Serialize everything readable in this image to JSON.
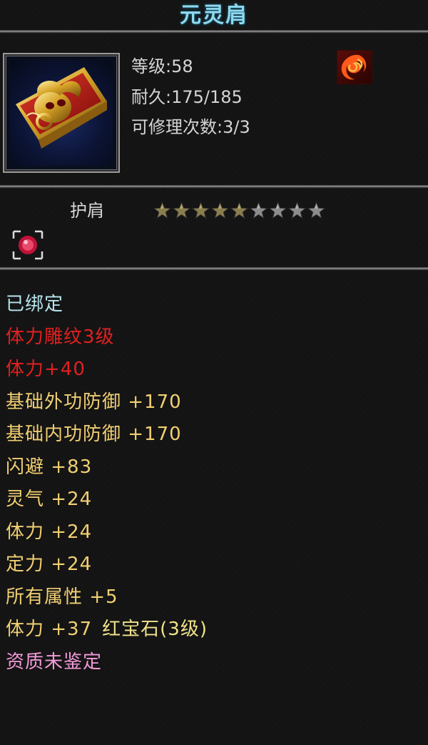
{
  "item": {
    "name": "元灵肩",
    "level_label": "等级",
    "level_value": "58",
    "durability_label": "耐久",
    "durability_value": "175/185",
    "repair_label": "可修理次数",
    "repair_value": "3/3",
    "type": "护肩",
    "stars_total": 9,
    "stars_filled": 5
  },
  "icons": {
    "item_icon": "red-gold-shoulder-armor-icon",
    "element_icon": "fire-swirl-icon",
    "gem_slot_icon": "red-gem-slot-icon",
    "star_icon": "star-icon"
  },
  "colors": {
    "title": "#8fd8ee",
    "bound": "#b6e4ec",
    "red": "#e02020",
    "gold": "#f1cf72",
    "gem": "#f0e28a",
    "pink": "#f29ad8",
    "star_filled": "#8a7d4e",
    "star_empty": "#8c8c8c"
  },
  "attributes": [
    {
      "text": "已绑定",
      "color": "#b6e4ec"
    },
    {
      "text": "体力雕纹3级",
      "color": "#e02020"
    },
    {
      "text": "体力+40",
      "color": "#e02020"
    },
    {
      "text": "基础外功防御  +170",
      "color": "#f1cf72"
    },
    {
      "text": "基础内功防御  +170",
      "color": "#f1cf72"
    },
    {
      "text": "闪避  +83",
      "color": "#f1cf72"
    },
    {
      "text": "灵气  +24",
      "color": "#f1cf72"
    },
    {
      "text": "体力  +24",
      "color": "#f1cf72"
    },
    {
      "text": "定力  +24",
      "color": "#f1cf72"
    },
    {
      "text": "所有属性  +5",
      "color": "#f1cf72"
    },
    {
      "text": "体力  +37",
      "color": "#f1cf72",
      "extra": "红宝石(3级)",
      "extra_color": "#f0e28a"
    },
    {
      "text": "资质未鉴定",
      "color": "#f29ad8"
    }
  ]
}
